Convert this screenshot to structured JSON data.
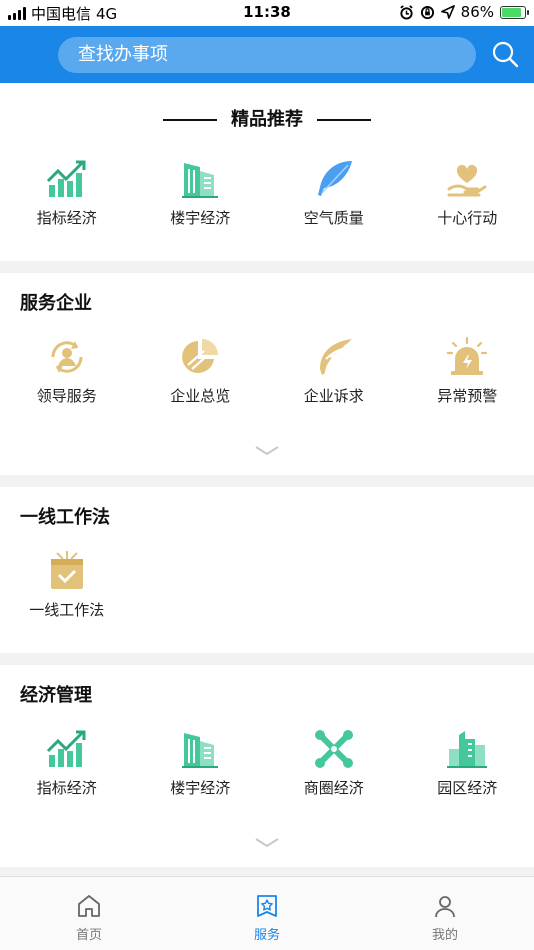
{
  "status_bar": {
    "carrier": "中国电信",
    "network": "4G",
    "time": "11:38",
    "battery": "86%",
    "battery_level": 0.86
  },
  "search": {
    "placeholder": "查找办事项"
  },
  "featured": {
    "title": "精品推荐",
    "items": [
      {
        "label": "指标经济",
        "icon": "trend-chart-icon"
      },
      {
        "label": "楼宇经济",
        "icon": "building-icon"
      },
      {
        "label": "空气质量",
        "icon": "feather-icon"
      },
      {
        "label": "十心行动",
        "icon": "heart-hand-icon"
      }
    ]
  },
  "service": {
    "title": "服务企业",
    "items": [
      {
        "label": "领导服务",
        "icon": "leader-service-icon"
      },
      {
        "label": "企业总览",
        "icon": "pie-chart-icon"
      },
      {
        "label": "企业诉求",
        "icon": "leaf-icon"
      },
      {
        "label": "异常预警",
        "icon": "alarm-light-icon"
      }
    ]
  },
  "frontline": {
    "title": "一线工作法",
    "items": [
      {
        "label": "一线工作法",
        "icon": "checkbox-box-icon"
      }
    ]
  },
  "economy": {
    "title": "经济管理",
    "items": [
      {
        "label": "指标经济",
        "icon": "trend-chart-icon"
      },
      {
        "label": "楼宇经济",
        "icon": "building-icon"
      },
      {
        "label": "商圈经济",
        "icon": "joomla-icon"
      },
      {
        "label": "园区经济",
        "icon": "park-buildings-icon"
      }
    ]
  },
  "tabbar": {
    "items": [
      {
        "label": "首页",
        "icon": "home-icon"
      },
      {
        "label": "服务",
        "icon": "star-tag-icon",
        "active": true
      },
      {
        "label": "我的",
        "icon": "person-icon"
      }
    ]
  },
  "colors": {
    "brand": "#1a86e8",
    "green": "#45c79c",
    "gold": "#e2c27a",
    "blue_feather": "#4a9ff0"
  }
}
